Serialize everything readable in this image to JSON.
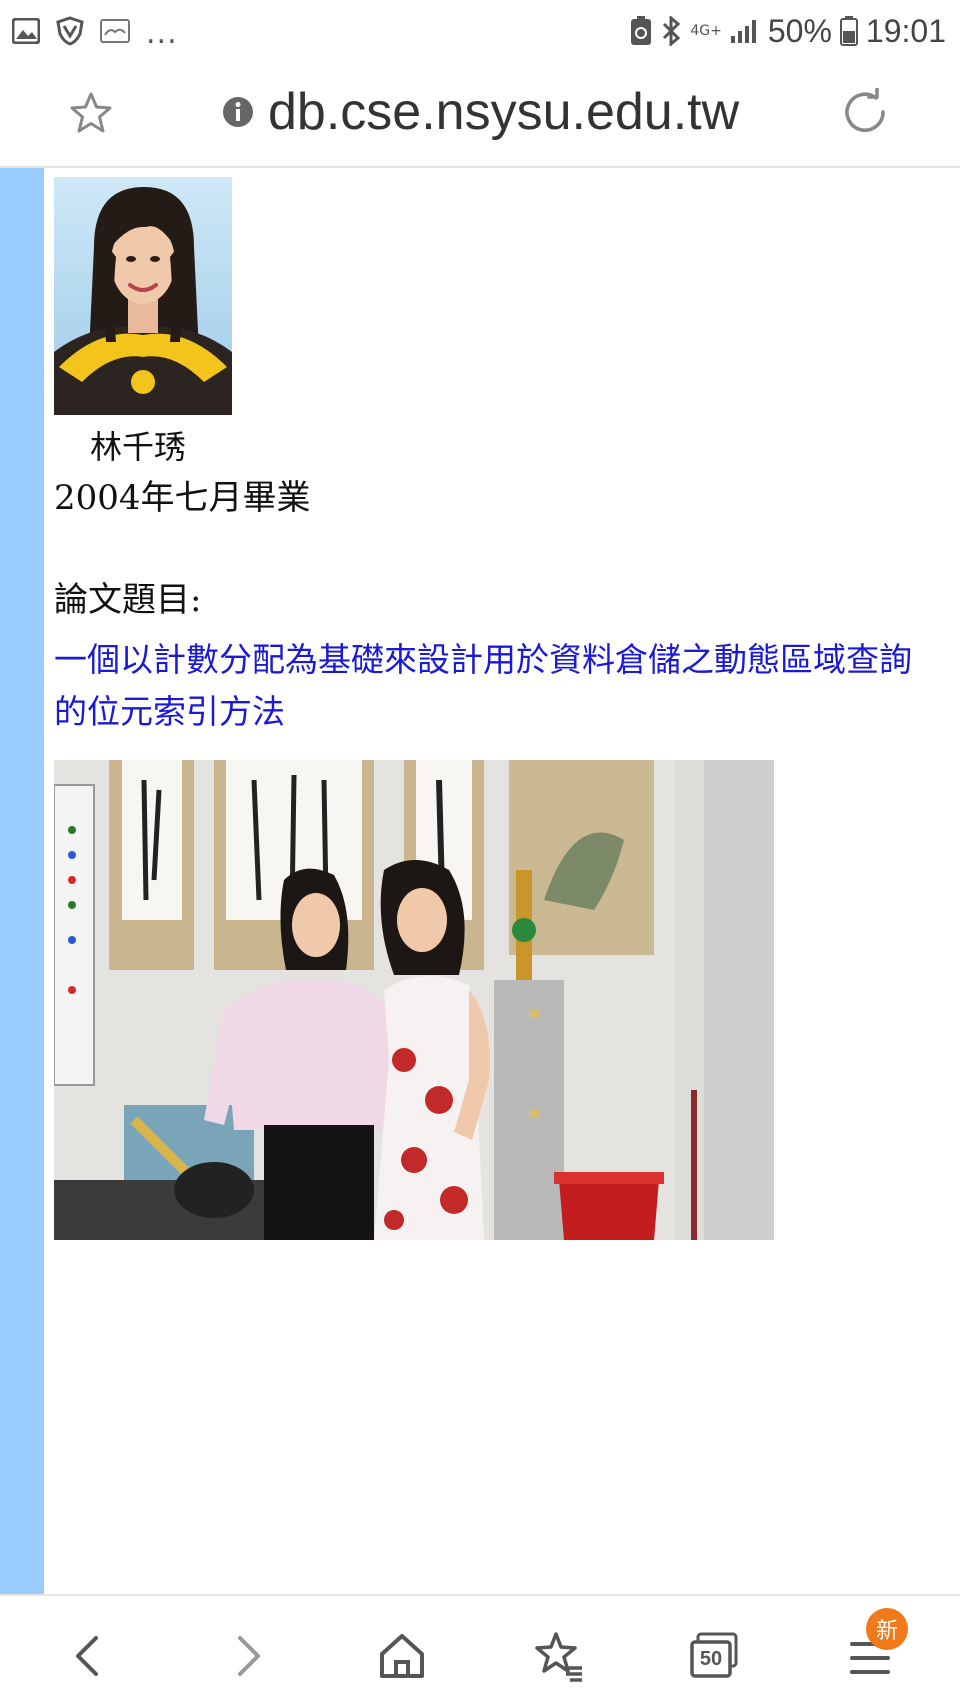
{
  "status_bar": {
    "overflow": "...",
    "network": "4G+",
    "battery": "50%",
    "time": "19:01"
  },
  "url_bar": {
    "url": "db.cse.nsysu.edu.tw"
  },
  "profile": {
    "name": "林千琇",
    "graduation": "2004年七月畢業",
    "thesis_label": "論文題目:",
    "thesis_title": "一個以計數分配為基礎來設計用於資料倉儲之動態區域查詢的位元索引方法"
  },
  "bottom_nav": {
    "tab_count": "50",
    "menu_badge": "新"
  },
  "colors": {
    "side_stripe": "#99ccff",
    "link": "#1a1ad4",
    "badge": "#f07a1a"
  }
}
